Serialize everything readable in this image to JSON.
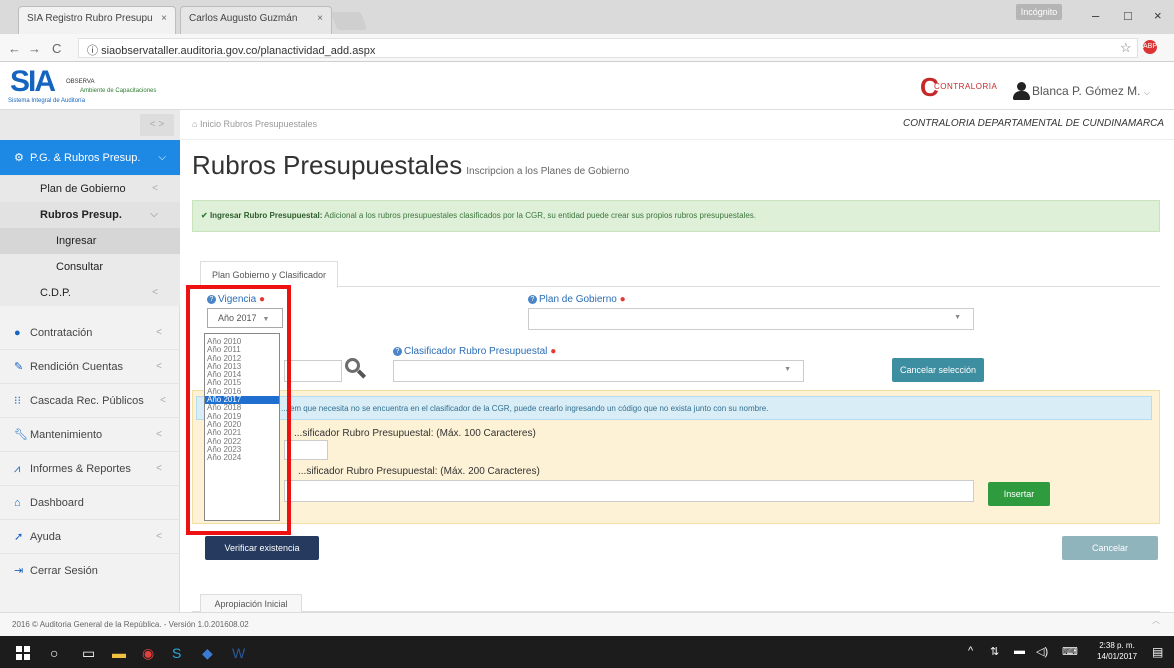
{
  "browser": {
    "tabs": [
      {
        "label": "SIA Registro Rubro Presupu"
      },
      {
        "label": "Carlos Augusto Guzmán"
      }
    ],
    "incognito_label": "Incógnito",
    "url": "siaobservataller.auditoria.gov.co/planactividad_add.aspx"
  },
  "header": {
    "logo": {
      "big": "SIA",
      "obs": "OBSERVA",
      "amb": "Ambiente de Capacitaciones",
      "full": "Sistema Integral de Auditoría"
    },
    "contraloria_logo": "CONTRALORIA",
    "user": "Blanca P. Gómez M."
  },
  "sidebar": {
    "pg": "P.G. & Rubros Presup.",
    "plan_gobierno": "Plan de Gobierno",
    "rubros": "Rubros Presup.",
    "ingresar": "Ingresar",
    "consultar": "Consultar",
    "cdp": "C.D.P.",
    "items": [
      {
        "label": "Contratación",
        "icon": "circle-icon"
      },
      {
        "label": "Rendición Cuentas",
        "icon": "edit-icon"
      },
      {
        "label": "Cascada Rec. Públicos",
        "icon": "grid-icon"
      },
      {
        "label": "Mantenimiento",
        "icon": "wrench-icon"
      },
      {
        "label": "Informes & Reportes",
        "icon": "chart-icon"
      },
      {
        "label": "Dashboard",
        "icon": "home-icon"
      },
      {
        "label": "Ayuda",
        "icon": "rocket-icon"
      },
      {
        "label": "Cerrar Sesión",
        "icon": "logout-icon"
      }
    ]
  },
  "breadcrumb": {
    "home": "Inicio",
    "current": "Rubros Presupuestales"
  },
  "org": "CONTRALORIA DEPARTAMENTAL DE CUNDINAMARCA",
  "page": {
    "title": "Rubros Presupuestales",
    "subtitle": "Inscripcion a los Planes de Gobierno"
  },
  "alert": {
    "bold": "Ingresar Rubro Presupuestal:",
    "text": "Adicional a los rubros presupuestales clasificados por la CGR, su entidad puede crear sus propios rubros presupuestales."
  },
  "tabs": {
    "plan": "Plan Gobierno y Clasificador",
    "apropiacion": "Apropiación Inicial"
  },
  "form": {
    "vigencia_label": "Vigencia",
    "vigencia_value": "Año 2017",
    "plan_label": "Plan de Gobierno",
    "clasificador_label": "Clasificador Rubro Presupuestal",
    "cancel_sel": "Cancelar selección",
    "info": "...tem que necesita no se encuentra en el clasificador de la CGR, puede crearlo ingresando un código que no exista junto con su nombre.",
    "codigo_label": "...sificador Rubro Presupuestal: (Máx. 100 Caracteres)",
    "nombre_label": "...sificador Rubro Presupuestal: (Máx. 200 Caracteres)",
    "insertar": "Insertar",
    "verificar": "Verificar existencia",
    "cancelar": "Cancelar"
  },
  "dropdown": {
    "options": [
      "Año 2010",
      "Año 2011",
      "Año 2012",
      "Año 2013",
      "Año 2014",
      "Año 2015",
      "Año 2016",
      "Año 2017",
      "Año 2018",
      "Año 2019",
      "Año 2020",
      "Año 2021",
      "Año 2022",
      "Año 2023",
      "Año 2024"
    ],
    "selected_index": 7
  },
  "footer": "2016 © Auditoria General de la República. - Versión 1.0.201608.02",
  "clock": {
    "time": "2:38 p. m.",
    "date": "14/01/2017"
  },
  "colors": {
    "accent": "#1e88e5",
    "highlight": "#ee1111",
    "success": "#2e9b3f"
  }
}
